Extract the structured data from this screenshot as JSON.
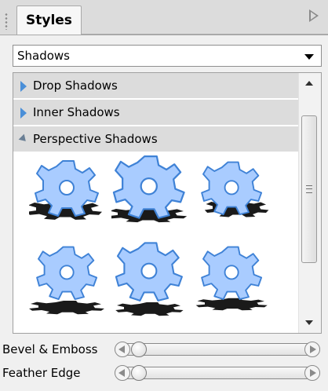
{
  "tab": {
    "label": "Styles"
  },
  "dropdown": {
    "value": "Shadows"
  },
  "sections": [
    {
      "label": "Drop Shadows",
      "expanded": false
    },
    {
      "label": "Inner Shadows",
      "expanded": false
    },
    {
      "label": "Perspective Shadows",
      "expanded": true
    }
  ],
  "presets": [
    {
      "icon": "gear-perspective-shadow-icon"
    },
    {
      "icon": "gear-perspective-shadow-icon"
    },
    {
      "icon": "gear-perspective-shadow-icon"
    },
    {
      "icon": "gear-perspective-shadow-icon"
    },
    {
      "icon": "gear-perspective-shadow-icon"
    },
    {
      "icon": "gear-perspective-shadow-icon"
    }
  ],
  "sliders": [
    {
      "label": "Bevel & Emboss",
      "value": 0
    },
    {
      "label": "Feather Edge",
      "value": 0
    }
  ],
  "colors": {
    "gear_fill": "#a9ccff",
    "gear_stroke": "#3f82d6",
    "shadow": "#1a1a1a",
    "expander_arrow": "#4a8fd8"
  }
}
